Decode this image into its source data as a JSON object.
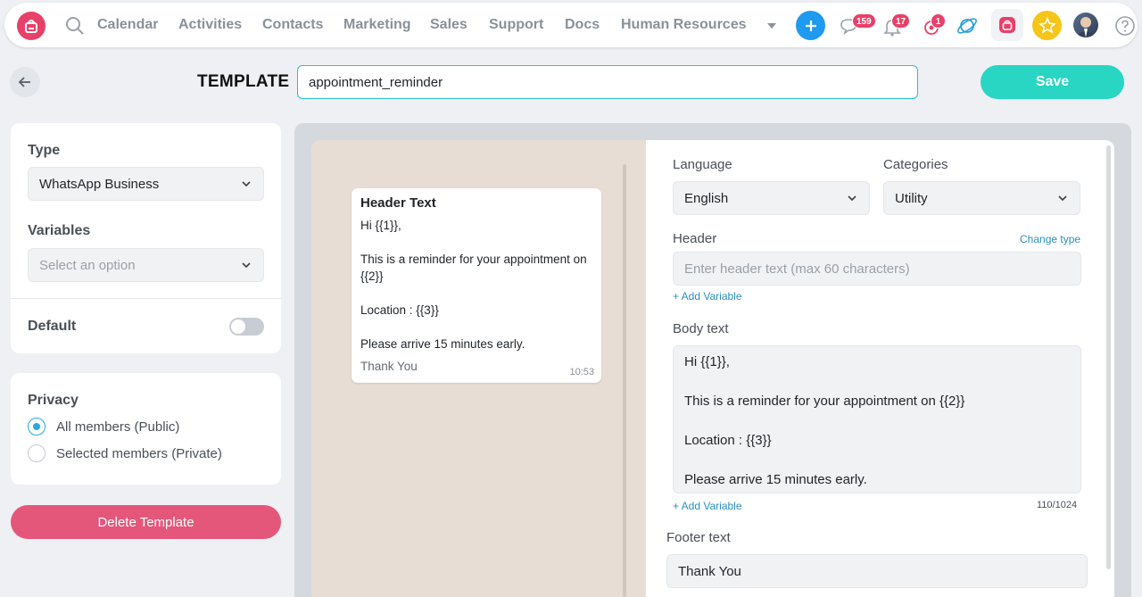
{
  "nav": {
    "items": [
      "Calendar",
      "Activities",
      "Contacts",
      "Marketing",
      "Sales",
      "Support",
      "Docs",
      "Human Resources"
    ],
    "badges": {
      "messages": "159",
      "notifications": "17",
      "activity": "1"
    }
  },
  "header": {
    "label": "TEMPLATE",
    "template_name": "appointment_reminder",
    "save_label": "Save"
  },
  "settings": {
    "type_label": "Type",
    "type_value": "WhatsApp Business",
    "variables_label": "Variables",
    "variables_placeholder": "Select an option",
    "default_label": "Default"
  },
  "privacy": {
    "label": "Privacy",
    "options": [
      "All members (Public)",
      "Selected members (Private)"
    ],
    "selected": "All members (Public)"
  },
  "delete_label": "Delete Template",
  "preview": {
    "header": "Header Text",
    "body": "Hi {{1}},\n\nThis is a reminder for your appointment on {{2}}\n\nLocation : {{3}}\n\nPlease arrive 15 minutes early.",
    "footer": "Thank You",
    "time": "10:53"
  },
  "form": {
    "language_label": "Language",
    "language_value": "English",
    "categories_label": "Categories",
    "categories_value": "Utility",
    "header_label": "Header",
    "change_type": "Change type",
    "header_placeholder": "Enter header text (max 60 characters)",
    "add_variable": "+ Add Variable",
    "body_label": "Body text",
    "body_value": "Hi {{1}},\n\nThis is a reminder for your appointment on {{2}}\n\nLocation : {{3}}\n\nPlease arrive 15 minutes early.",
    "counter": "110/1024",
    "footer_label": "Footer text",
    "footer_value": "Thank You"
  },
  "colors": {
    "brand": "#e84068",
    "accent": "#28d6c3",
    "danger": "#e4577a",
    "link": "#2a8fc4"
  }
}
